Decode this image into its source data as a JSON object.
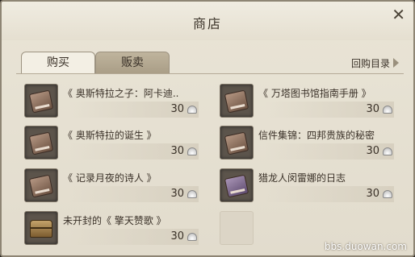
{
  "window": {
    "title": "商店"
  },
  "tabs": [
    {
      "label": "购买",
      "active": true
    },
    {
      "label": "贩卖",
      "active": false
    }
  ],
  "back_link": {
    "label": "回购目录"
  },
  "currency": {
    "icon": "shell-icon"
  },
  "items": [
    {
      "name": "《 奥斯特拉之子：阿卡迪..",
      "price": "30",
      "icon": "book-icon"
    },
    {
      "name": "《 万塔图书馆指南手册 》",
      "price": "30",
      "icon": "book-icon"
    },
    {
      "name": "《 奥斯特拉的诞生 》",
      "price": "30",
      "icon": "book-icon"
    },
    {
      "name": "信件集锦：四邦贵族的秘密",
      "price": "30",
      "icon": "book-icon"
    },
    {
      "name": "《 记录月夜的诗人 》",
      "price": "30",
      "icon": "book-icon"
    },
    {
      "name": "猎龙人闵雷娜的日志",
      "price": "30",
      "icon": "purple-book-icon"
    },
    {
      "name": "未开封的《 擎天赞歌 》",
      "price": "30",
      "icon": "chest-icon"
    }
  ],
  "watermark": "bbs.duowan.com"
}
